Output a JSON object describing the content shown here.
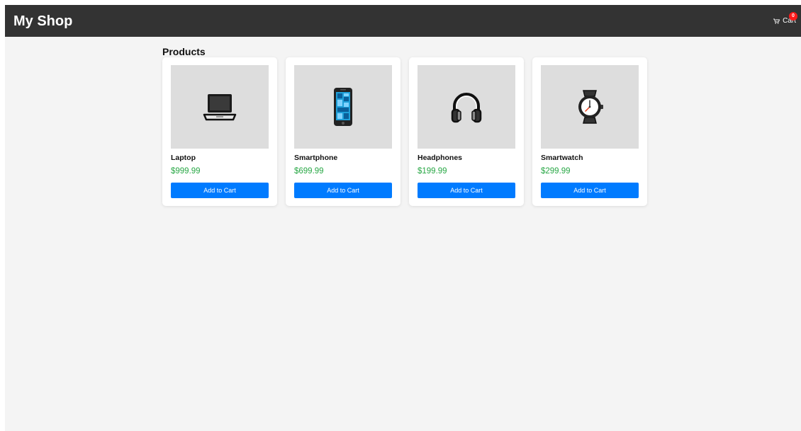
{
  "header": {
    "brand": "My Shop",
    "cart_label": "Cart",
    "cart_count": "0",
    "cart_icon": "shopping-cart-icon"
  },
  "main": {
    "section_title": "Products",
    "products": [
      {
        "name": "Laptop",
        "price": "$999.99",
        "button_label": "Add to Cart",
        "icon": "laptop-icon"
      },
      {
        "name": "Smartphone",
        "price": "$699.99",
        "button_label": "Add to Cart",
        "icon": "smartphone-icon"
      },
      {
        "name": "Headphones",
        "price": "$199.99",
        "button_label": "Add to Cart",
        "icon": "headphones-icon"
      },
      {
        "name": "Smartwatch",
        "price": "$299.99",
        "button_label": "Add to Cart",
        "icon": "watch-icon"
      }
    ]
  },
  "colors": {
    "navbar": "#333333",
    "background": "#f4f4f4",
    "price": "#28a745",
    "button": "#007bff",
    "badge": "#ff1a1a"
  }
}
